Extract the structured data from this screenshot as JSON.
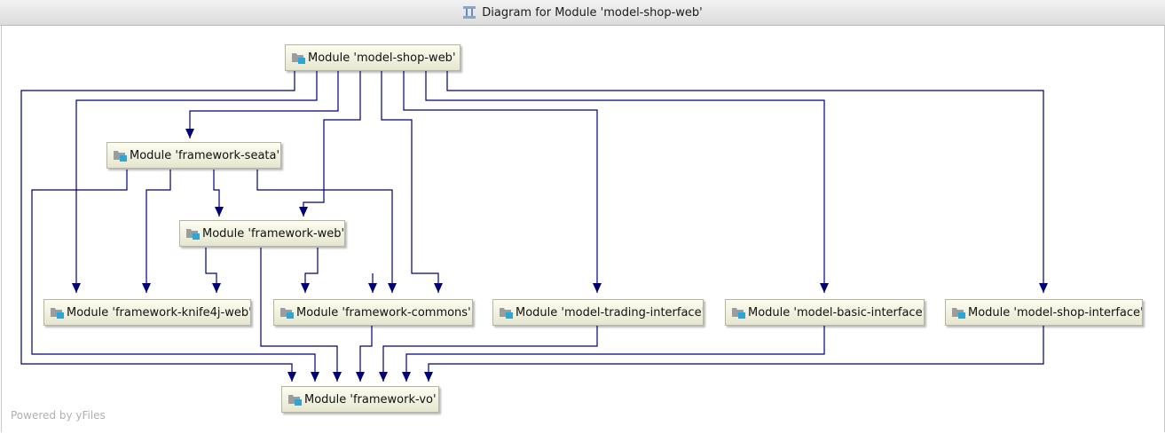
{
  "window": {
    "title": "Diagram for Module 'model-shop-web'",
    "title_icon": "diagram-icon"
  },
  "nodes": {
    "model_shop_web": "Module 'model-shop-web'",
    "framework_seata": "Module 'framework-seata'",
    "framework_web": "Module 'framework-web'",
    "framework_knife4j_web": "Module 'framework-knife4j-web'",
    "framework_commons": "Module 'framework-commons'",
    "model_trading_interface": "Module 'model-trading-interface'",
    "model_basic_interface": "Module 'model-basic-interface'",
    "model_shop_interface": "Module 'model-shop-interface'",
    "framework_vo": "Module 'framework-vo'"
  },
  "dependencies": [
    [
      "model_shop_web",
      "framework_vo"
    ],
    [
      "model_shop_web",
      "framework_knife4j_web"
    ],
    [
      "model_shop_web",
      "framework_seata"
    ],
    [
      "model_shop_web",
      "framework_web"
    ],
    [
      "model_shop_web",
      "framework_commons"
    ],
    [
      "model_shop_web",
      "model_trading_interface"
    ],
    [
      "model_shop_web",
      "model_basic_interface"
    ],
    [
      "model_shop_web",
      "model_shop_interface"
    ],
    [
      "framework_seata",
      "framework_vo"
    ],
    [
      "framework_seata",
      "framework_knife4j_web"
    ],
    [
      "framework_seata",
      "framework_web"
    ],
    [
      "framework_seata",
      "framework_commons"
    ],
    [
      "framework_web",
      "framework_knife4j_web"
    ],
    [
      "framework_web",
      "framework_vo"
    ],
    [
      "framework_web",
      "framework_commons"
    ],
    [
      "framework_commons",
      "framework_vo"
    ],
    [
      "model_trading_interface",
      "framework_vo"
    ],
    [
      "model_basic_interface",
      "framework_vo"
    ],
    [
      "model_shop_interface",
      "framework_vo"
    ]
  ],
  "colors": {
    "edge": "#00007a",
    "node_border": "#b5b5a0",
    "module_icon_accent": "#2aa7d8"
  },
  "footer": "Powered by yFiles"
}
